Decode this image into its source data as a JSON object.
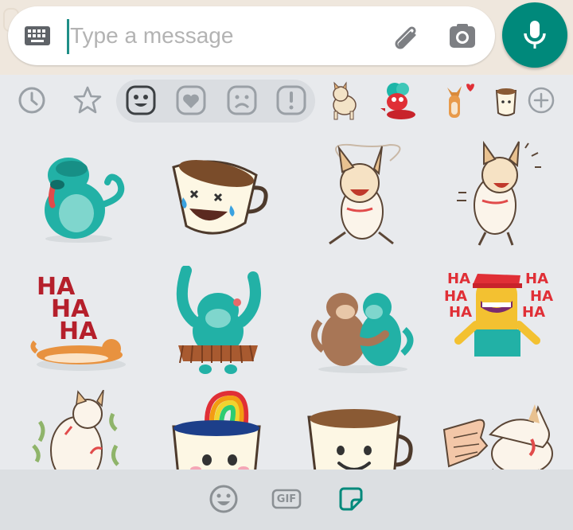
{
  "compose": {
    "placeholder": "Type a message",
    "value": ""
  },
  "icons": {
    "keyboard": "keyboard-icon",
    "attach": "paperclip-icon",
    "camera": "camera-icon",
    "mic": "microphone-icon"
  },
  "colors": {
    "accent": "#00897b",
    "cursor": "#1f8f87",
    "icon_gray": "#9aa0a6",
    "selected_icon": "#3c4043",
    "sticker_tab_active": "#00897b"
  },
  "tabs": [
    {
      "name": "recent",
      "icon": "clock-icon",
      "selected": false
    },
    {
      "name": "favorites",
      "icon": "star-icon",
      "selected": false
    },
    {
      "name": "happy",
      "icon": "smiley-face-icon",
      "selected": true
    },
    {
      "name": "love",
      "icon": "heart-face-icon",
      "selected": false
    },
    {
      "name": "sad",
      "icon": "sad-face-icon",
      "selected": false
    },
    {
      "name": "surprised",
      "icon": "exclamation-face-icon",
      "selected": false
    }
  ],
  "packs": [
    {
      "name": "shiba-dog-pack",
      "icon": "shiba-dog-thumbnail"
    },
    {
      "name": "red-bird-pack",
      "icon": "red-bird-thumbnail"
    },
    {
      "name": "fox-love-pack",
      "icon": "fox-heart-thumbnail"
    },
    {
      "name": "cup-pack",
      "icon": "cup-thumbnail"
    }
  ],
  "stickers": [
    [
      "monkey-tongue-sticker",
      "crying-laughing-cup-sticker",
      "happy-shiba-sticker",
      "excited-shiba-sticker"
    ],
    [
      "haha-dog-sticker",
      "dancing-monkey-sticker",
      "monkeys-hug-sticker",
      "haha-laughing-guy-sticker"
    ],
    [
      "rolling-dog-sticker",
      "rainbow-cup-sticker",
      "smiling-cup-sticker",
      "hand-dog-sticker"
    ]
  ],
  "sticker_texts": {
    "haha_left": [
      "HA",
      "HA",
      "HA"
    ],
    "haha_right": [
      "HA",
      "HA",
      "HA",
      "HA",
      "HA",
      "HA"
    ]
  },
  "bottom": {
    "emoji_icon": "emoji-icon",
    "gif_label": "GIF",
    "sticker_icon": "sticker-icon"
  }
}
